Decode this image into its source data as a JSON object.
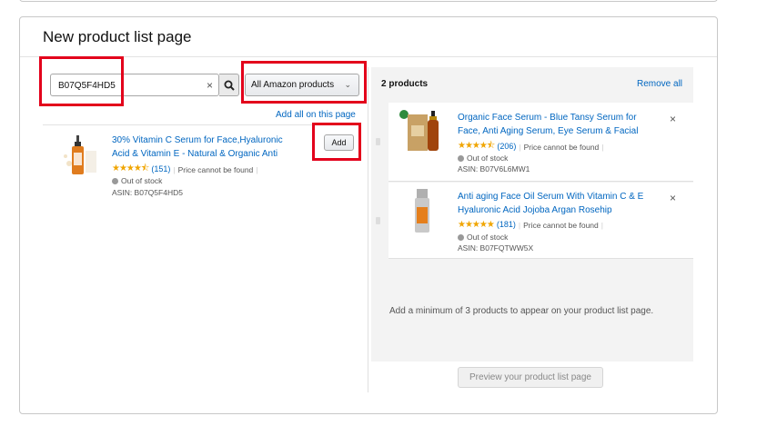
{
  "page_title": "New product list page",
  "search": {
    "value": "B07Q5F4HD5",
    "clear_icon": "close-icon",
    "button_icon": "search-icon"
  },
  "filter": {
    "selected": "All Amazon products"
  },
  "add_all_label": "Add all on this page",
  "results": [
    {
      "title_line1": "30% Vitamin C Serum for Face,Hyaluronic",
      "title_line2": "Acid & Vitamin E - Natural & Organic Anti",
      "rating": 4.5,
      "review_count": "(151)",
      "price_text": "Price cannot be found",
      "stock": "Out of stock",
      "asin": "ASIN: B07Q5F4HD5",
      "add_label": "Add"
    }
  ],
  "selected_panel": {
    "count_label": "2 products",
    "remove_all_label": "Remove all",
    "items": [
      {
        "title_line1": "Organic Face Serum - Blue Tansy Serum for",
        "title_line2": "Face, Anti Aging Serum, Eye Serum & Facial",
        "rating": 4.5,
        "review_count": "(206)",
        "price_text": "Price cannot be found",
        "stock": "Out of stock",
        "asin": "ASIN: B07V6L6MW1"
      },
      {
        "title_line1": "Anti aging Face Oil Serum With Vitamin C & E",
        "title_line2": "Hyaluronic Acid Jojoba Argan Rosehip",
        "rating": 5,
        "review_count": "(181)",
        "price_text": "Price cannot be found",
        "stock": "Out of stock",
        "asin": "ASIN: B07FQTWW5X"
      }
    ],
    "minimum_note": "Add a minimum of 3 products to appear on your product list page.",
    "preview_label": "Preview your product list page"
  },
  "colors": {
    "link": "#0066c0",
    "highlight": "#e3001b",
    "star": "#f0a500"
  }
}
